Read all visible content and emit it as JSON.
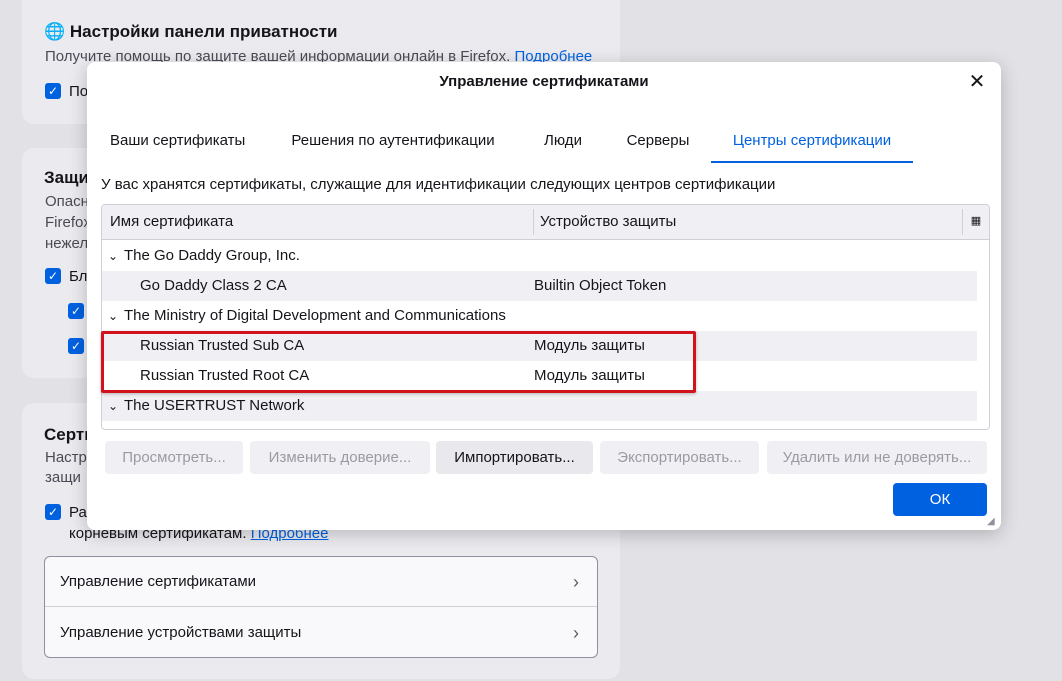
{
  "background": {
    "privacy_card": {
      "title": "Настройки панели приватности",
      "description": "Получите помощь по защите вашей информации онлайн в Firefox.",
      "link": "Подробнее",
      "checkbox_label": "По"
    },
    "protection_card": {
      "title": "Защи",
      "line1": "Опасн",
      "line2": "Firefox",
      "line3": "нежел",
      "checkbox_label": "Бл"
    },
    "certificates_card": {
      "title": "Серти",
      "line1": "Настр",
      "line2": "защи",
      "checkbox_label": "Раз",
      "checkbox_line2": "корневым сертификатам.",
      "link": "Подробнее",
      "nav_items": [
        {
          "label": "Управление сертификатами"
        },
        {
          "label": "Управление устройствами защиты"
        }
      ]
    }
  },
  "dialog": {
    "title": "Управление сертификатами",
    "tabs": [
      {
        "label": "Ваши сертификаты",
        "active": false
      },
      {
        "label": "Решения по аутентификации",
        "active": false
      },
      {
        "label": "Люди",
        "active": false
      },
      {
        "label": "Серверы",
        "active": false
      },
      {
        "label": "Центры сертификации",
        "active": true
      }
    ],
    "description": "У вас хранятся сертификаты, служащие для идентификации следующих центров сертификации",
    "columns": {
      "name": "Имя сертификата",
      "device": "Устройство защиты"
    },
    "rows": [
      {
        "type": "group",
        "name": "The Go Daddy Group, Inc.",
        "device": ""
      },
      {
        "type": "cert",
        "name": "Go Daddy Class 2 CA",
        "device": "Builtin Object Token"
      },
      {
        "type": "group",
        "name": "The Ministry of Digital Development and Communications",
        "device": ""
      },
      {
        "type": "cert",
        "name": "Russian Trusted Sub CA",
        "device": "Модуль защиты"
      },
      {
        "type": "cert",
        "name": "Russian Trusted Root CA",
        "device": "Модуль защиты"
      },
      {
        "type": "group",
        "name": "The USERTRUST Network",
        "device": ""
      }
    ],
    "buttons": {
      "view": "Просмотреть...",
      "edit_trust": "Изменить доверие...",
      "import": "Импортировать...",
      "export": "Экспортировать...",
      "delete": "Удалить или не доверять...",
      "ok": "ОК"
    }
  },
  "colors": {
    "accent": "#0061e0",
    "highlight_border": "#d2121c"
  },
  "icons": {
    "globe": "globe-icon",
    "close": "close-icon",
    "twisty": "chevron-down-icon",
    "column_picker": "column-picker-icon",
    "nav_chevron": "chevron-right-icon",
    "checkbox": "checkmark-icon"
  }
}
